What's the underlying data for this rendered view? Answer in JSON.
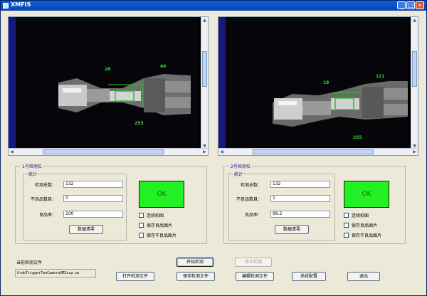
{
  "window": {
    "title": "XMFIS",
    "min_glyph": "_",
    "max_glyph": "□",
    "close_glyph": "×"
  },
  "viewers": [
    {
      "roi_labels": [
        "28",
        "40",
        "255"
      ]
    },
    {
      "roi_labels": [
        "18",
        "121",
        "255"
      ]
    }
  ],
  "stations": [
    {
      "title": "1号检测位",
      "stats_title": "统计",
      "count_label": "检测总数：",
      "count_value": "132",
      "defect_label": "不良品数目：",
      "defect_value": "0",
      "yield_label": "良品率：",
      "yield_value": "100",
      "clear_button": "数据清零",
      "result": "OK",
      "result_color": "#22f022",
      "options": [
        "连续拍图",
        "保存良品图片",
        "保存不良品图片"
      ]
    },
    {
      "title": "2号检测位",
      "stats_title": "统计",
      "count_label": "检测总数：",
      "count_value": "132",
      "defect_label": "不良品数目：",
      "defect_value": "1",
      "yield_label": "良品率：",
      "yield_value": "99.2",
      "clear_button": "数据清零",
      "result": "OK",
      "result_color": "#22f022",
      "options": [
        "连续拍图",
        "保存良品图片",
        "保存不良品图片"
      ]
    }
  ],
  "bottom": {
    "current_file_label": "当前检测文件",
    "current_file_value": "GrabTriggerTwoCameraXMZzsp.vp",
    "start_button": "开始检测",
    "stop_button": "停止检测",
    "open_file_button": "打开检测文件",
    "save_file_button": "保存检测文件",
    "edit_file_button": "编辑检测文件",
    "settings_button": "系统配置",
    "exit_button": "退出"
  }
}
